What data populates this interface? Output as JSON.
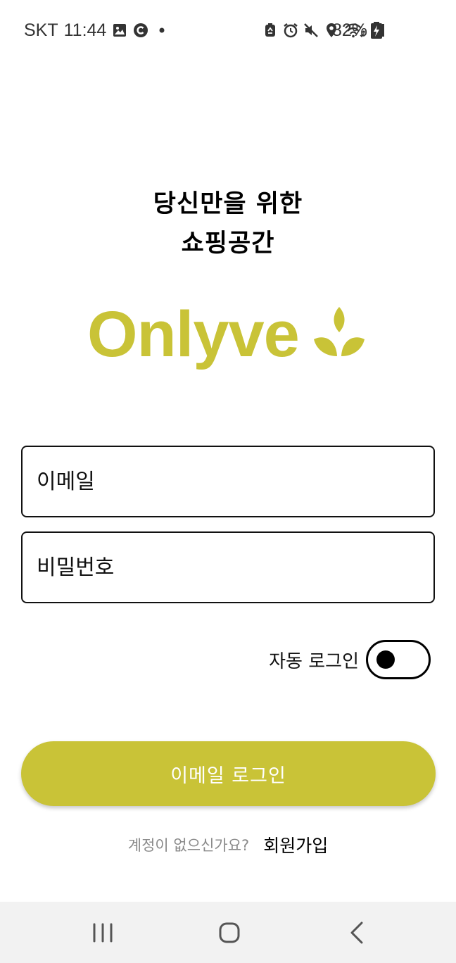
{
  "status_bar": {
    "carrier": "SKT",
    "time": "11:44",
    "battery_percent": "82%",
    "icons": [
      "gallery-icon",
      "c-icon",
      "dot-icon",
      "recycle-icon",
      "alarm-icon",
      "mute-icon",
      "location-icon",
      "wifi-icon",
      "signal-icon",
      "battery-charging-icon"
    ]
  },
  "headline": {
    "line1": "당신만을 위한",
    "line2": "쇼핑공간"
  },
  "logo": {
    "text": "Onlyve",
    "color": "#c9c337",
    "icon": "leaf-icon"
  },
  "form": {
    "email_placeholder": "이메일",
    "password_placeholder": "비밀번호",
    "auto_login_label": "자동 로그인",
    "auto_login_enabled": false,
    "login_button_label": "이메일 로그인",
    "accent_color": "#c9c337"
  },
  "signup": {
    "question": "계정이 없으신가요?",
    "link_label": "회원가입"
  },
  "nav_bar": {
    "icons": [
      "recent-apps-icon",
      "home-icon",
      "back-icon"
    ]
  }
}
